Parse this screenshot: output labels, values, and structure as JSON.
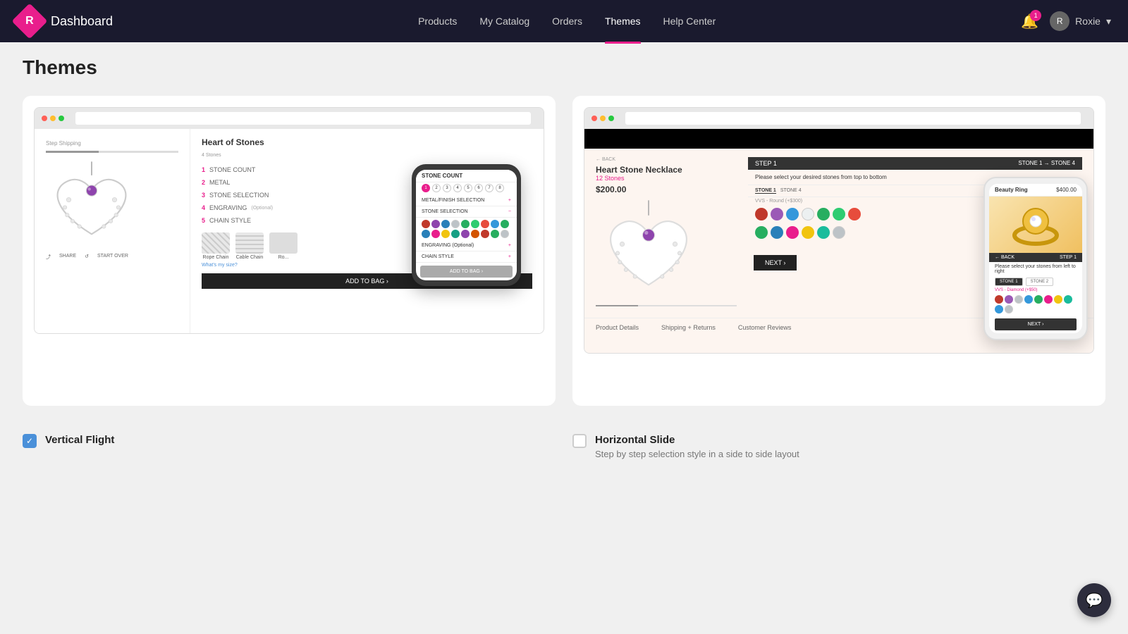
{
  "header": {
    "logo_text": "R",
    "title": "Dashboard",
    "nav_items": [
      {
        "label": "Products",
        "active": false
      },
      {
        "label": "My Catalog",
        "active": false
      },
      {
        "label": "Orders",
        "active": false
      },
      {
        "label": "Themes",
        "active": true
      },
      {
        "label": "Help Center",
        "active": false
      }
    ],
    "notification_badge": "1",
    "user_name": "Roxie"
  },
  "page": {
    "title": "Themes"
  },
  "theme_left": {
    "name": "Vertical Flight",
    "checked": true,
    "product_title": "Heart of Stones",
    "steps": [
      {
        "num": "1",
        "label": "STONE COUNT"
      },
      {
        "num": "2",
        "label": "METAL"
      },
      {
        "num": "3",
        "label": "STONE SELECTION"
      },
      {
        "num": "4",
        "label": "ENGRAVING",
        "optional": "(Optional)"
      },
      {
        "num": "5",
        "label": "CHAIN STYLE"
      }
    ],
    "chain_options": [
      {
        "label": "Rope Chain"
      },
      {
        "label": "Cable Chain"
      },
      {
        "label": "Ro..."
      }
    ],
    "add_btn_label": "ADD TO BAG ›",
    "phone": {
      "steps": [
        "STONE COUNT",
        "METAL/FINISH SELECTION",
        "STONE SELECTION",
        "ENGRAVING (Optional)",
        "CHAIN STYLE"
      ],
      "add_btn": "ADD TO BAG ›",
      "stone_nums": [
        "1",
        "2",
        "3",
        "4",
        "5",
        "6",
        "7",
        "8"
      ],
      "stone_colors": [
        "#c0392b",
        "#8e44ad",
        "#2980b9",
        "#27ae60",
        "#f39c12",
        "#1abc9c",
        "#e74c3c",
        "#3498db",
        "#27ae60",
        "#2980b9",
        "#e91e8c",
        "#f1c40f",
        "#16a085",
        "#8e44ad",
        "#d35400",
        "#c0392b",
        "#27ae60",
        "#e91e8c"
      ]
    }
  },
  "theme_right": {
    "name": "Horizontal Slide",
    "checked": false,
    "description": "Step by step selection style in a side to side layout",
    "product_title": "Heart Stone Necklace",
    "subtitle": "12 Stones",
    "price": "$200.00",
    "step_label": "STEP 1",
    "next_btn": "NEXT ›",
    "tabs": [
      "Product Details",
      "Shipping + Returns",
      "Customer Reviews"
    ],
    "stone_colors_row1": [
      "#c0392b",
      "#9b59b6",
      "#3498db",
      "#ecf0f1",
      "#27ae60",
      "#2ecc71",
      "#e74c3c"
    ],
    "stone_colors_row2": [
      "#27ae60",
      "#2980b9",
      "#e91e8c",
      "#f1c40f",
      "#1abc9c",
      "#bdc3c7"
    ],
    "phone": {
      "beauty_title": "Beauty Ring",
      "beauty_price": "$400.00",
      "step_label": "STEP 1",
      "select_text": "Please select your stones from left to right",
      "tabs": [
        "STONE 1",
        "STONE 2"
      ],
      "price_range": "VVS - Diamond (+$50)",
      "next_btn": "NEXT ›",
      "stone_colors": [
        "#c0392b",
        "#9b59b6",
        "#bdc3c7",
        "#3498db",
        "#27ae60",
        "#e91e8c",
        "#f1c40f",
        "#1abc9c",
        "#3498db",
        "#bdc3c7"
      ]
    }
  },
  "icons": {
    "bell": "🔔",
    "user": "👤",
    "chevron_down": "▾",
    "share": "⤴",
    "refresh": "↺",
    "plus": "+",
    "checkmark": "✓",
    "chat": "💬"
  }
}
